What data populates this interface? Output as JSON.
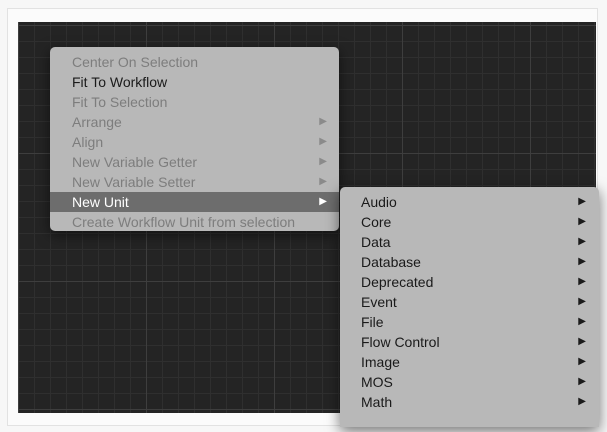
{
  "context_menu": {
    "items": [
      {
        "label": "Center On Selection",
        "enabled": false,
        "submenu": false
      },
      {
        "label": "Fit To Workflow",
        "enabled": true,
        "submenu": false
      },
      {
        "label": "Fit To Selection",
        "enabled": false,
        "submenu": false
      },
      {
        "label": "Arrange",
        "enabled": false,
        "submenu": true
      },
      {
        "label": "Align",
        "enabled": false,
        "submenu": true
      },
      {
        "label": "New Variable Getter",
        "enabled": false,
        "submenu": true
      },
      {
        "label": "New Variable Setter",
        "enabled": false,
        "submenu": true
      },
      {
        "label": "New Unit",
        "enabled": true,
        "submenu": true,
        "highlighted": true
      },
      {
        "label": "Create Workflow Unit from selection",
        "enabled": false,
        "submenu": false
      }
    ]
  },
  "submenu": {
    "items": [
      {
        "label": "Audio"
      },
      {
        "label": "Core"
      },
      {
        "label": "Data"
      },
      {
        "label": "Database"
      },
      {
        "label": "Deprecated"
      },
      {
        "label": "Event"
      },
      {
        "label": "File"
      },
      {
        "label": "Flow Control"
      },
      {
        "label": "Image"
      },
      {
        "label": "MOS"
      },
      {
        "label": "Math"
      }
    ]
  },
  "glyphs": {
    "submenu_arrow": "▶"
  },
  "colors": {
    "canvas": "#242424",
    "menu_background": "#b8b8b8",
    "highlight": "#6d6d6d",
    "disabled_text": "#7d7d7d"
  }
}
